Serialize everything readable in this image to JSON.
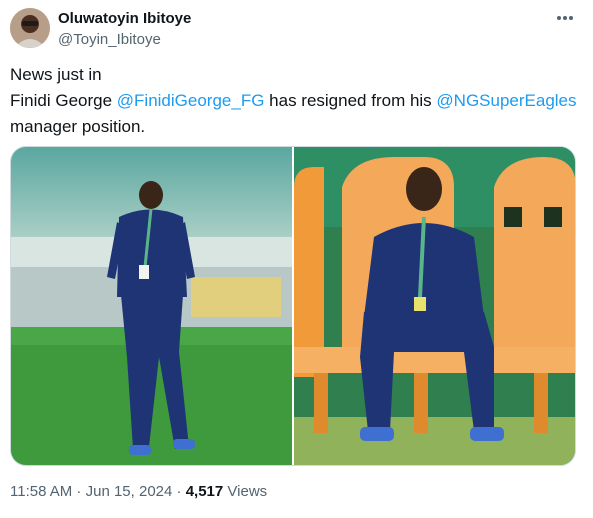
{
  "author": {
    "name": "Oluwatoyin Ibitoye",
    "handle": "@Toyin_Ibitoye"
  },
  "tweet": {
    "line1": "News just in",
    "line2_prefix": "Finidi George ",
    "mention1": "@FinidiGeorge_FG",
    "line2_middle": " has resigned from his ",
    "mention2": "@NGSuperEagles",
    "line3": "manager position."
  },
  "meta": {
    "time": "11:58 AM",
    "sep1": " · ",
    "date": "Jun 15, 2024",
    "sep2": " · ",
    "views_count": "4,517",
    "views_label": " Views"
  },
  "colors": {
    "link": "#1d9bf0",
    "muted": "#536471",
    "text": "#0f1419"
  },
  "icons": {
    "more": "more-horizontal-icon"
  }
}
